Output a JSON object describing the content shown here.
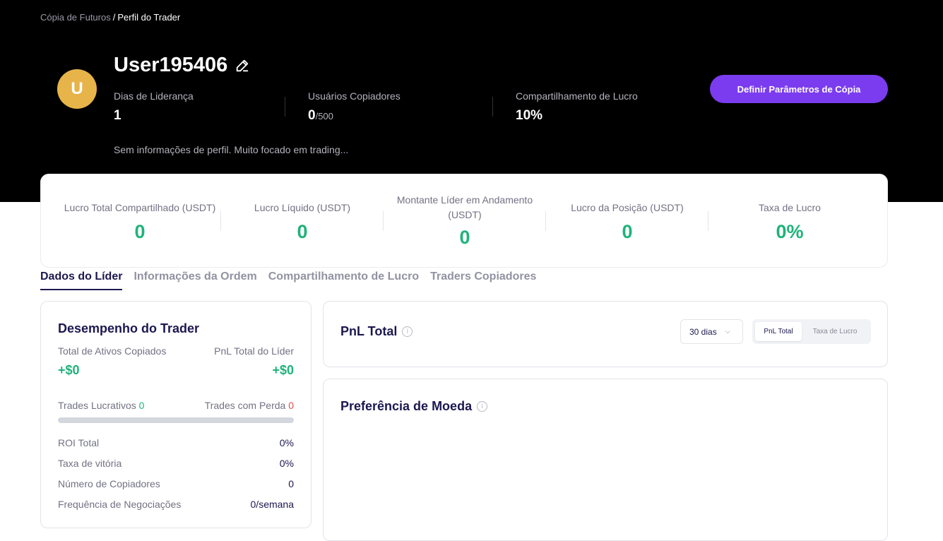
{
  "breadcrumb": {
    "parent": "Cópia de Futuros",
    "separator": "/",
    "current": "Perfil do Trader"
  },
  "profile": {
    "avatar_letter": "U",
    "avatar_color": "#e7b44a",
    "username": "User195406",
    "stats": [
      {
        "label": "Dias de Liderança",
        "value": "1",
        "suffix": ""
      },
      {
        "label": "Usuários Copiadores",
        "value": "0",
        "suffix": "/500"
      },
      {
        "label": "Compartilhamento de Lucro",
        "value": "10%",
        "suffix": ""
      }
    ],
    "bio": "Sem informações de perfil. Muito focado em trading...",
    "copy_button": "Definir Parâmetros de Cópia"
  },
  "summary": [
    {
      "label": "Lucro Total Compartilhado (USDT)",
      "value": "0"
    },
    {
      "label": "Lucro Líquido (USDT)",
      "value": "0"
    },
    {
      "label": "Montante Líder em Andamento (USDT)",
      "value": "0"
    },
    {
      "label": "Lucro da Posição (USDT)",
      "value": "0"
    },
    {
      "label": "Taxa de Lucro",
      "value": "0%"
    }
  ],
  "tabs": [
    {
      "label": "Dados do Líder",
      "active": true
    },
    {
      "label": "Informações da Ordem",
      "active": false
    },
    {
      "label": "Compartilhamento de Lucro",
      "active": false
    },
    {
      "label": "Traders Copiadores",
      "active": false
    }
  ],
  "performance": {
    "title": "Desempenho do Trader",
    "copied_assets_label": "Total de Ativos Copiados",
    "copied_assets_value": "+$0",
    "leader_pnl_label": "PnL Total do Líder",
    "leader_pnl_value": "+$0",
    "profitable_label": "Trades Lucrativos",
    "profitable_value": "0",
    "loss_label": "Trades com Perda",
    "loss_value": "0",
    "rows": [
      {
        "key": "ROI Total",
        "value": "0%"
      },
      {
        "key": "Taxa de vitória",
        "value": "0%"
      },
      {
        "key": "Número de Copiadores",
        "value": "0"
      },
      {
        "key": "Frequência de Negociações",
        "value": "0/semana"
      }
    ]
  },
  "pnl": {
    "title": "PnL Total",
    "period": "30 dias",
    "toggle_on": "PnL Total",
    "toggle_off": "Taxa de Lucro"
  },
  "preference": {
    "title": "Preferência de Moeda"
  },
  "colors": {
    "accent": "#7b3cf0",
    "positive": "#1fb37a",
    "negative": "#e54b4b",
    "heading": "#1c1850"
  }
}
